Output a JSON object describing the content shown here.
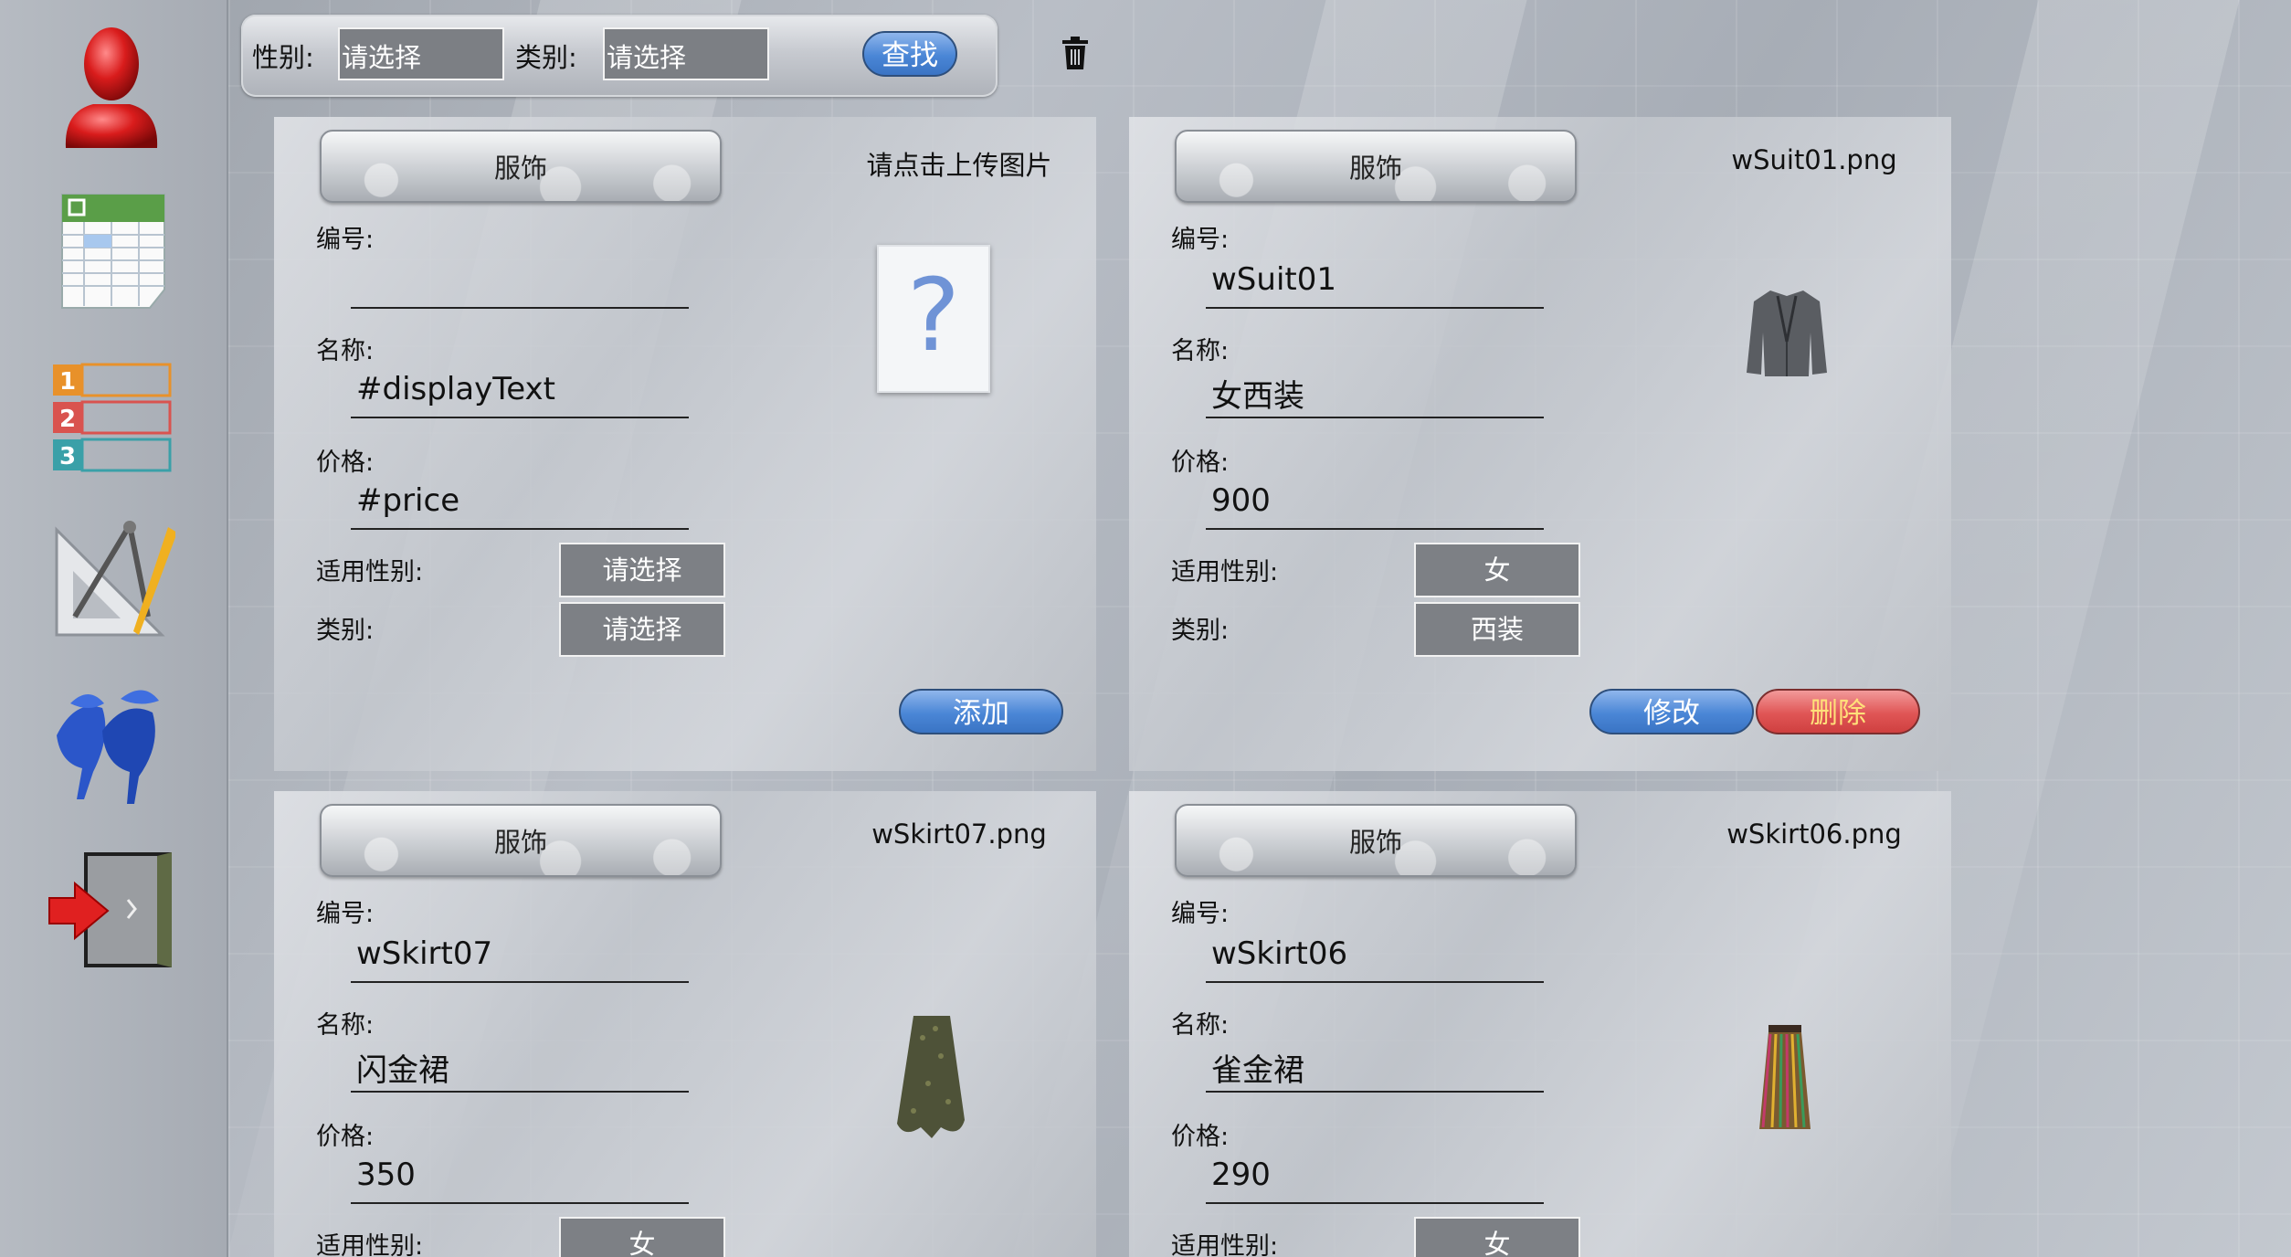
{
  "filter": {
    "gender_label": "性别:",
    "gender_value": "请选择",
    "category_label": "类别:",
    "category_value": "请选择",
    "search_label": "查找"
  },
  "sidebar": {
    "items": [
      "user-icon",
      "spreadsheet-icon",
      "numbered-list-icon",
      "drafting-tools-icon",
      "shoes-icon",
      "exit-door-icon"
    ]
  },
  "cards": [
    {
      "category_button": "服饰",
      "image_name": "请点击上传图片",
      "id_label": "编号:",
      "id_value": "",
      "name_label": "名称:",
      "name_value": "#displayText",
      "price_label": "价格:",
      "price_value": "#price",
      "gender_label": "适用性别:",
      "gender_value": "请选择",
      "category_label": "类别:",
      "category_value": "请选择",
      "add_label": "添加",
      "image_placeholder": "?"
    },
    {
      "category_button": "服饰",
      "image_name": "wSuit01.png",
      "id_label": "编号:",
      "id_value": "wSuit01",
      "name_label": "名称:",
      "name_value": "女西装",
      "price_label": "价格:",
      "price_value": "900",
      "gender_label": "适用性别:",
      "gender_value": "女",
      "category_label": "类别:",
      "category_value": "西装",
      "edit_label": "修改",
      "delete_label": "删除"
    },
    {
      "category_button": "服饰",
      "image_name": "wSkirt07.png",
      "id_label": "编号:",
      "id_value": "wSkirt07",
      "name_label": "名称:",
      "name_value": "闪金裙",
      "price_label": "价格:",
      "price_value": "350",
      "gender_label": "适用性别:",
      "gender_value": "女"
    },
    {
      "category_button": "服饰",
      "image_name": "wSkirt06.png",
      "id_label": "编号:",
      "id_value": "wSkirt06",
      "name_label": "名称:",
      "name_value": "雀金裙",
      "price_label": "价格:",
      "price_value": "290",
      "gender_label": "适用性别:",
      "gender_value": "女"
    }
  ]
}
